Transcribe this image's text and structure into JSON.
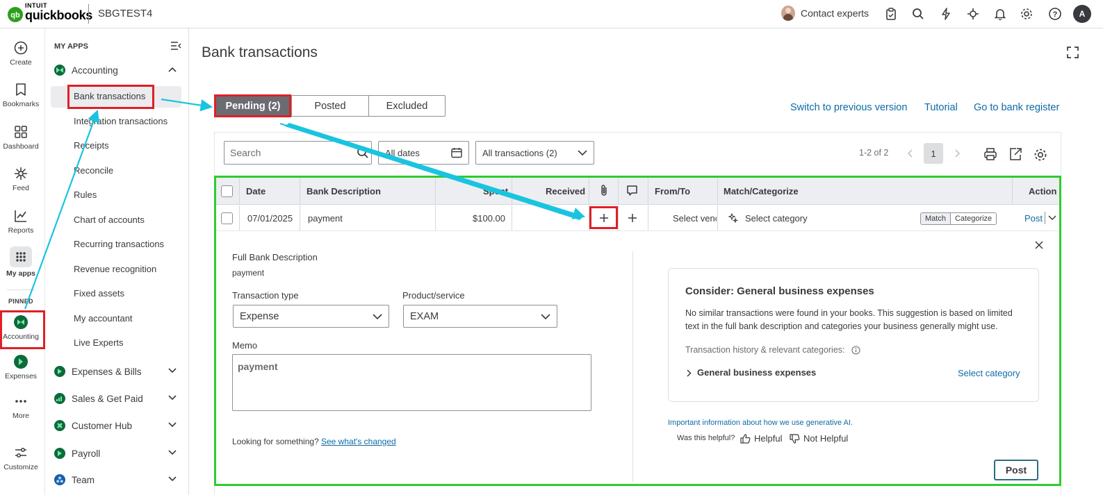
{
  "topbar": {
    "brand_top": "INTUIT",
    "brand_name": "quickbooks",
    "company": "SBGTEST4",
    "contact_label": "Contact experts",
    "avatar_initial": "A"
  },
  "rail": {
    "items": [
      {
        "label": "Create",
        "icon": "plus-circle-icon"
      },
      {
        "label": "Bookmarks",
        "icon": "bookmark-icon"
      },
      {
        "label": "Dashboard",
        "icon": "grid-icon"
      },
      {
        "label": "Feed",
        "icon": "sparkle-icon"
      },
      {
        "label": "Reports",
        "icon": "chart-icon"
      },
      {
        "label": "My apps",
        "icon": "apps-icon"
      }
    ],
    "pinned_label": "PINNED",
    "pinned": [
      {
        "label": "Accounting"
      },
      {
        "label": "Expenses"
      },
      {
        "label": "More"
      }
    ],
    "customize_label": "Customize"
  },
  "sidebar": {
    "title": "MY APPS",
    "accounting": "Accounting",
    "items": [
      "Bank transactions",
      "Integration transactions",
      "Receipts",
      "Reconcile",
      "Rules",
      "Chart of accounts",
      "Recurring transactions",
      "Revenue recognition",
      "Fixed assets",
      "My accountant",
      "Live Experts"
    ],
    "groups": [
      "Expenses & Bills",
      "Sales & Get Paid",
      "Customer Hub",
      "Payroll",
      "Team"
    ]
  },
  "main": {
    "title": "Bank transactions",
    "tabs": [
      "Pending (2)",
      "Posted",
      "Excluded"
    ],
    "links": [
      "Switch to previous version",
      "Tutorial",
      "Go to bank register"
    ]
  },
  "filters": {
    "search_placeholder": "Search",
    "dates": "All dates",
    "transactions": "All transactions (2)",
    "pager": "1-2 of 2",
    "page": "1"
  },
  "table": {
    "headers": [
      "Date",
      "Bank Description",
      "Spent",
      "Received",
      "From/To",
      "Match/Categorize",
      "Action"
    ],
    "row": {
      "date": "07/01/2025",
      "description": "payment",
      "spent": "$100.00",
      "received": "",
      "from_to": "Select venc",
      "category": "Select category",
      "match": "Match",
      "categorize": "Categorize",
      "action": "Post"
    }
  },
  "detail": {
    "full_desc_label": "Full Bank Description",
    "full_desc": "payment",
    "type_label": "Transaction type",
    "type_value": "Expense",
    "product_label": "Product/service",
    "product_value": "EXAM",
    "memo_label": "Memo",
    "memo_value": "payment",
    "looking": "Looking for something?",
    "whats_changed": "See what's changed"
  },
  "suggestion": {
    "title": "Consider: General business expenses",
    "body": "No similar transactions were found in your books. This suggestion is based on limited text in the full bank description and categories your business generally might use.",
    "history_label": "Transaction history & relevant categories:",
    "category": "General business expenses",
    "select": "Select category",
    "ai_note": "Important information about how we use generative AI.",
    "helpful_q": "Was this helpful?",
    "helpful": "Helpful",
    "not_helpful": "Not Helpful",
    "post": "Post"
  },
  "colors": {
    "accent": "#0d6ba8",
    "highlight_red": "#e01f26",
    "highlight_green": "#2ecc2e",
    "arrow": "#19c4e0"
  }
}
